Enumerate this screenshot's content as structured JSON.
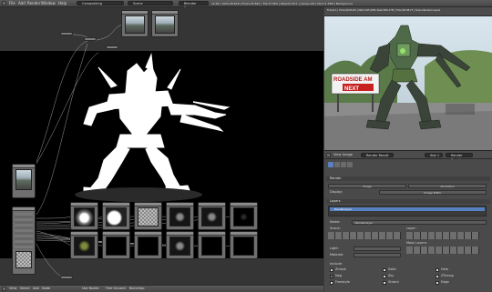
{
  "topbar": {
    "menus": [
      "File",
      "Add",
      "Render",
      "Window",
      "Help"
    ],
    "screen": "Compositing",
    "scene": "Scene",
    "engine": "Blender Render",
    "stats": "v2.64 | Verts:28,818 | Faces:25,842 | Tris:27,984 | Objects:5/11 | Lamps:0/0 | Mem:1.35M | Background"
  },
  "node_editor": {
    "bottom_menus": [
      "View",
      "Select",
      "Add",
      "Node"
    ],
    "bottom_fields": [
      "Use Nodes",
      "Free Unused",
      "Backdrop"
    ]
  },
  "viewer": {
    "header_text": "Frame:1 | Time:00:00.04 | Mem:245.45M, Peak:269.17M | Time:00:08.27 | Scene:Render-Layers",
    "sign_text": [
      "ROADSIDE AM",
      "NEXT"
    ]
  },
  "image_editor_bottom": {
    "menus": [
      "View",
      "Image"
    ],
    "slot": "Slot 1",
    "pass": "Render Result"
  },
  "properties": {
    "header": "Render Result",
    "panels": {
      "render": "Render",
      "layers": "Layers"
    },
    "render_buttons": [
      "Image",
      "Animation"
    ],
    "display_label": "Display:",
    "display_value": "Image Editor",
    "layer_item": "RenderLayer",
    "name_label": "Name:",
    "name_value": "RenderLayer",
    "scene_label": "Scene:",
    "layer_label": "Layer:",
    "light_label": "Light:",
    "material_label": "Material:",
    "mask_label": "Mask Layers:",
    "include_label": "Include:",
    "passes": [
      "Zmask",
      "Solid",
      "Halo",
      "Sky",
      "ZTransp",
      "Strand",
      "Edge",
      "Freestyle"
    ],
    "extra": "Neg"
  },
  "colors": {
    "backdrop": "#000000",
    "selection": "#5680c2",
    "panel": "#4a4a4a"
  }
}
